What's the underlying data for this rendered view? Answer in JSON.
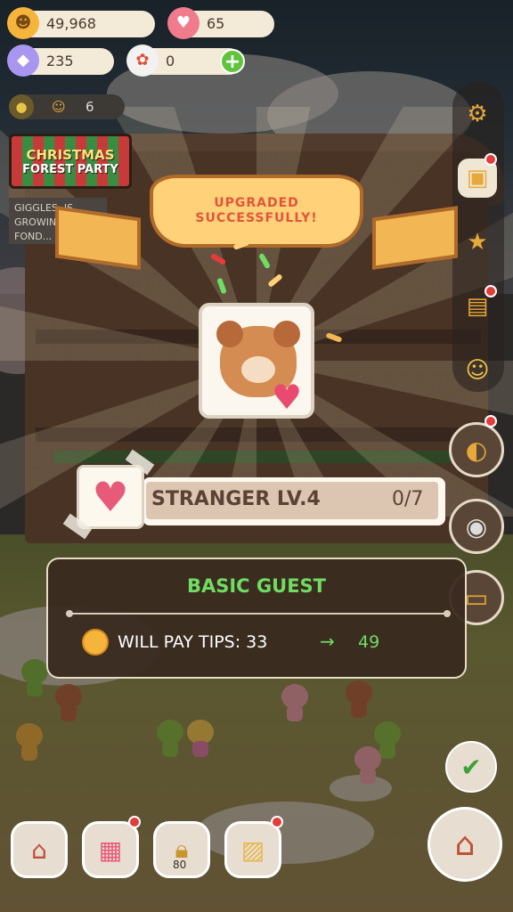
{
  "currencies": {
    "coins": "49,968",
    "gems": "65",
    "crystals": "235",
    "flowers": "0",
    "level_count": "6"
  },
  "event": {
    "line1": "CHRISTMAS",
    "line2": "FOREST PARTY"
  },
  "tip_text": "GIGGLES, IS GROWING... FOND...",
  "banner": {
    "line1": "UPGRADED",
    "line2": "SUCCESSFULLY!"
  },
  "relationship": {
    "label": "STRANGER LV.4",
    "progress": "0/7",
    "progress_fraction": 0
  },
  "guest_panel": {
    "title": "BASIC GUEST",
    "tips_label": "WILL PAY TIPS: 33",
    "arrow": "→",
    "tips_new": "49"
  },
  "bottom_bar": {
    "lock_count": "80"
  },
  "icons": {
    "coin": "coin-icon",
    "gem": "gem-icon",
    "crystal": "crystal-icon",
    "flower": "flower-icon",
    "plus": "plus-icon",
    "settings": "gear-icon",
    "heart": "heart-icon"
  },
  "colors": {
    "accent_green": "#6fdc62",
    "banner_yellow": "#ffd178",
    "banner_text": "#e0553c",
    "heart_pink": "#e85a7a",
    "notification_red": "#e23c3c"
  }
}
